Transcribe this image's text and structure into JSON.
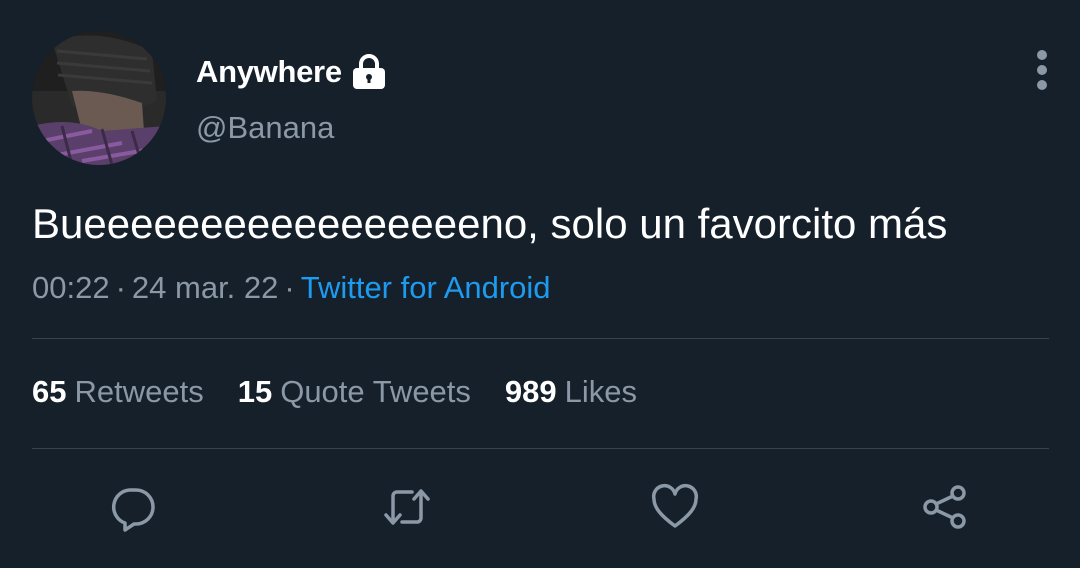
{
  "author": {
    "display_name": "Anywhere",
    "handle": "@Banana",
    "avatar_icon": "profile-photo",
    "protected_icon": "lock-icon"
  },
  "menu": {
    "icon": "more-vertical-icon"
  },
  "tweet": {
    "text": "Bueeeeeeeeeeeeeeeeeno, solo un favorcito más",
    "time": "00:22",
    "date": "24 mar. 22",
    "separator": "·",
    "source": "Twitter for Android"
  },
  "stats": {
    "retweets": {
      "count": "65",
      "label": "Retweets"
    },
    "quotes": {
      "count": "15",
      "label": "Quote Tweets"
    },
    "likes": {
      "count": "989",
      "label": "Likes"
    }
  },
  "actions": [
    {
      "name": "reply",
      "icon": "reply-icon"
    },
    {
      "name": "retweet",
      "icon": "retweet-icon"
    },
    {
      "name": "like",
      "icon": "heart-icon"
    },
    {
      "name": "share",
      "icon": "share-icon"
    }
  ],
  "colors": {
    "background": "#15202b",
    "primary_text": "#ffffff",
    "secondary_text": "#8b98a5",
    "accent": "#1d9bf0",
    "divider": "#38444d"
  }
}
